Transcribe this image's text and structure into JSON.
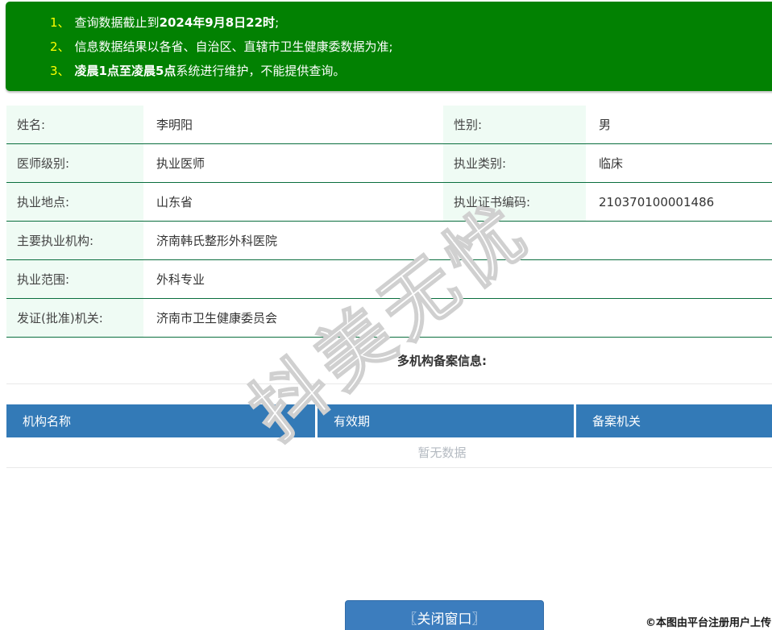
{
  "notice": {
    "items": [
      {
        "num": "1、",
        "pre": "查询数据截止到",
        "bold": "2024年9月8日22时",
        "post": ";"
      },
      {
        "num": "2、",
        "pre": "信息数据结果以各省、自治区、直辖市卫生健康委数据为准;",
        "bold": "",
        "post": ""
      },
      {
        "num": "3、",
        "pre": "",
        "bold": "凌晨1点至凌晨5点",
        "post": "系统进行维护，不能提供查询。"
      }
    ]
  },
  "info": {
    "rows": [
      {
        "label1": "姓名:",
        "value1": "李明阳",
        "label2": "性别:",
        "value2": "男"
      },
      {
        "label1": "医师级别:",
        "value1": "执业医师",
        "label2": "执业类别:",
        "value2": "临床"
      },
      {
        "label1": "执业地点:",
        "value1": "山东省",
        "label2": "执业证书编码:",
        "value2": "210370100001486"
      },
      {
        "label1": "主要执业机构:",
        "value1": "济南韩氏整形外科医院"
      },
      {
        "label1": "执业范围:",
        "value1": "外科专业"
      },
      {
        "label1": "发证(批准)机关:",
        "value1": "济南市卫生健康委员会"
      }
    ]
  },
  "multi_org": {
    "title": "多机构备案信息:",
    "columns": [
      "机构名称",
      "有效期",
      "备案机关"
    ],
    "empty_text": "暂无数据"
  },
  "footer": {
    "close_button": "〖关闭窗口〗",
    "copyright": "©本图由平台注册用户上传"
  },
  "watermark": "抖美无忧",
  "colors": {
    "banner_green": "#028102",
    "notice_number_yellow": "#ffff00",
    "row_border_green": "#0a6e3e",
    "label_bg": "#effbf4",
    "header_blue": "#337ab7",
    "button_blue": "#3c7dbe",
    "empty_text_gray": "#b4bac1"
  }
}
